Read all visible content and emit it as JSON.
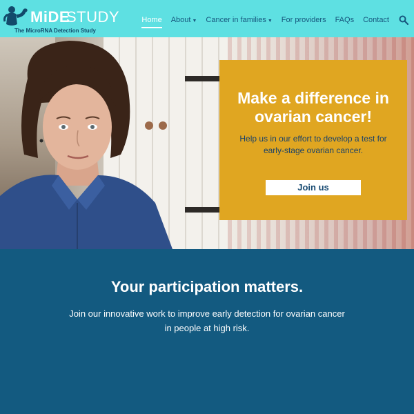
{
  "header": {
    "logo": {
      "mide": "MiDE",
      "study": "STUDY",
      "tagline": "The MicroRNA Detection Study"
    },
    "nav": [
      {
        "label": "Home",
        "active": true,
        "dropdown": false
      },
      {
        "label": "About",
        "active": false,
        "dropdown": true
      },
      {
        "label": "Cancer in families",
        "active": false,
        "dropdown": true
      },
      {
        "label": "For providers",
        "active": false,
        "dropdown": false
      },
      {
        "label": "FAQs",
        "active": false,
        "dropdown": false
      },
      {
        "label": "Contact",
        "active": false,
        "dropdown": false
      }
    ],
    "search_icon": "search-icon"
  },
  "hero": {
    "card": {
      "title": "Make a difference in ovarian cancer!",
      "text": "Help us in our effort to develop a test for early-stage ovarian cancer.",
      "button": "Join us"
    }
  },
  "participation": {
    "title": "Your participation matters.",
    "text": "Join our innovative work to improve early detection for ovarian cancer in people at high risk."
  },
  "colors": {
    "header_bg": "#5ee0e2",
    "nav_text": "#17577e",
    "card_bg": "#e0a621",
    "section_bg": "#135a80"
  }
}
